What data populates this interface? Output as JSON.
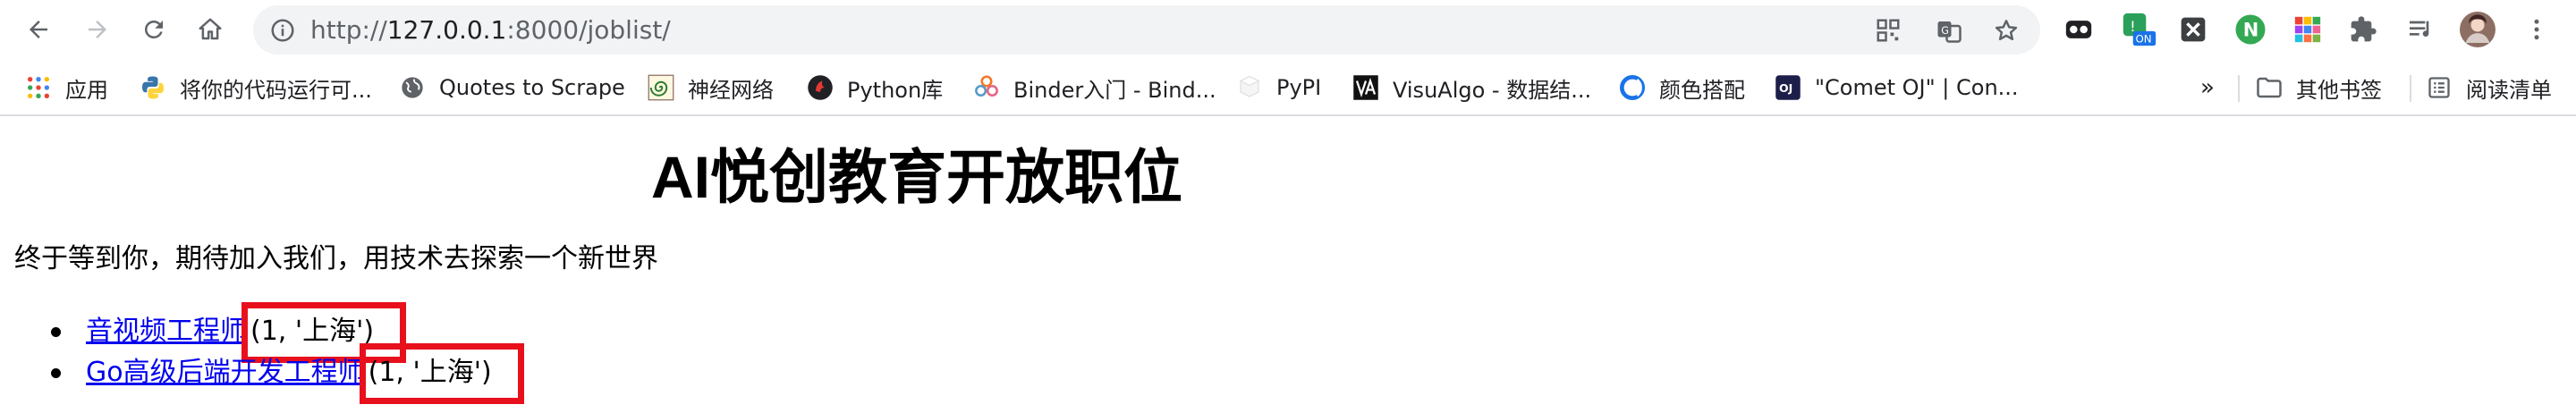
{
  "toolbar": {
    "url_prefix": "http://",
    "url_host": "127.0.0.1",
    "url_rest": ":8000/joblist/",
    "extension_badge": "ON"
  },
  "bookmarks": [
    {
      "label": "应用",
      "icon": "apps-grid-icon"
    },
    {
      "label": "将你的代码运行可...",
      "icon": "python-icon"
    },
    {
      "label": "Quotes to Scrape",
      "icon": "globe-icon"
    },
    {
      "label": "神经网络",
      "icon": "spiral-icon"
    },
    {
      "label": "Python库",
      "icon": "python-lib-icon"
    },
    {
      "label": "Binder入门 - Bind...",
      "icon": "binder-icon"
    },
    {
      "label": "PyPI",
      "icon": "pypi-icon"
    },
    {
      "label": "VisuAlgo - 数据结...",
      "icon": "visualgo-icon"
    },
    {
      "label": "颜色搭配",
      "icon": "color-icon"
    },
    {
      "label": "\"Comet OJ\" | Con...",
      "icon": "cometoj-icon"
    }
  ],
  "bookmarks_overflow": "»",
  "other_bookmarks": "其他书签",
  "reading_list": "阅读清单",
  "page": {
    "title": "AI悦创教育开放职位",
    "intro": "终于等到你，期待加入我们，用技术去探索一个新世界",
    "jobs": [
      {
        "title": "音视频工程师",
        "meta": "(1, '上海')"
      },
      {
        "title": "Go高级后端开发工程师",
        "meta": "(1, '上海')"
      }
    ]
  },
  "colors": {
    "link": "#0000ee",
    "highlight_box": "#e8101d",
    "omnibox_bg": "#f1f3f4"
  }
}
